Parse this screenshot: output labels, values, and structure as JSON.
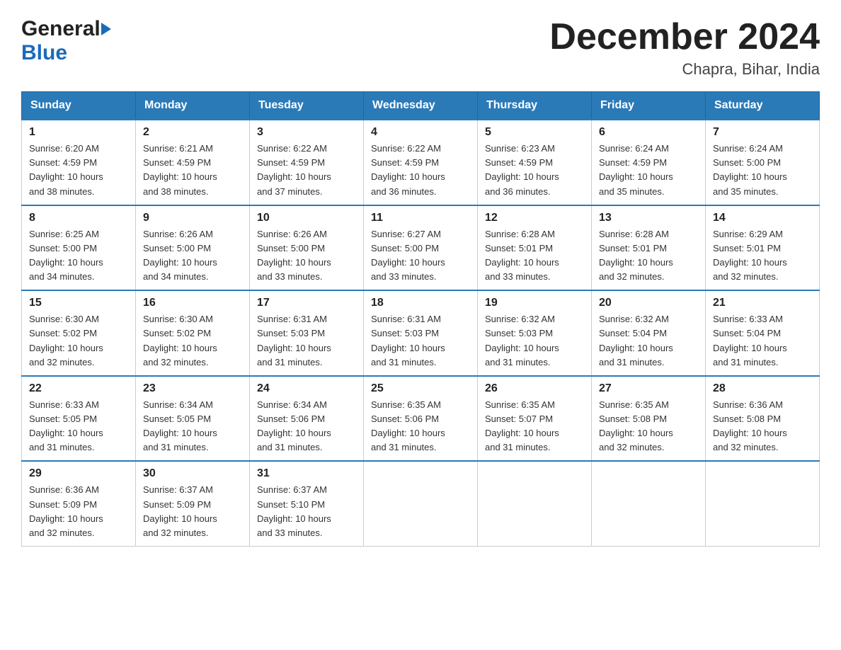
{
  "header": {
    "logo_general": "General",
    "logo_blue": "Blue",
    "month_title": "December 2024",
    "location": "Chapra, Bihar, India"
  },
  "calendar": {
    "days_of_week": [
      "Sunday",
      "Monday",
      "Tuesday",
      "Wednesday",
      "Thursday",
      "Friday",
      "Saturday"
    ],
    "weeks": [
      [
        {
          "day": "1",
          "sunrise": "6:20 AM",
          "sunset": "4:59 PM",
          "daylight": "10 hours and 38 minutes."
        },
        {
          "day": "2",
          "sunrise": "6:21 AM",
          "sunset": "4:59 PM",
          "daylight": "10 hours and 38 minutes."
        },
        {
          "day": "3",
          "sunrise": "6:22 AM",
          "sunset": "4:59 PM",
          "daylight": "10 hours and 37 minutes."
        },
        {
          "day": "4",
          "sunrise": "6:22 AM",
          "sunset": "4:59 PM",
          "daylight": "10 hours and 36 minutes."
        },
        {
          "day": "5",
          "sunrise": "6:23 AM",
          "sunset": "4:59 PM",
          "daylight": "10 hours and 36 minutes."
        },
        {
          "day": "6",
          "sunrise": "6:24 AM",
          "sunset": "4:59 PM",
          "daylight": "10 hours and 35 minutes."
        },
        {
          "day": "7",
          "sunrise": "6:24 AM",
          "sunset": "5:00 PM",
          "daylight": "10 hours and 35 minutes."
        }
      ],
      [
        {
          "day": "8",
          "sunrise": "6:25 AM",
          "sunset": "5:00 PM",
          "daylight": "10 hours and 34 minutes."
        },
        {
          "day": "9",
          "sunrise": "6:26 AM",
          "sunset": "5:00 PM",
          "daylight": "10 hours and 34 minutes."
        },
        {
          "day": "10",
          "sunrise": "6:26 AM",
          "sunset": "5:00 PM",
          "daylight": "10 hours and 33 minutes."
        },
        {
          "day": "11",
          "sunrise": "6:27 AM",
          "sunset": "5:00 PM",
          "daylight": "10 hours and 33 minutes."
        },
        {
          "day": "12",
          "sunrise": "6:28 AM",
          "sunset": "5:01 PM",
          "daylight": "10 hours and 33 minutes."
        },
        {
          "day": "13",
          "sunrise": "6:28 AM",
          "sunset": "5:01 PM",
          "daylight": "10 hours and 32 minutes."
        },
        {
          "day": "14",
          "sunrise": "6:29 AM",
          "sunset": "5:01 PM",
          "daylight": "10 hours and 32 minutes."
        }
      ],
      [
        {
          "day": "15",
          "sunrise": "6:30 AM",
          "sunset": "5:02 PM",
          "daylight": "10 hours and 32 minutes."
        },
        {
          "day": "16",
          "sunrise": "6:30 AM",
          "sunset": "5:02 PM",
          "daylight": "10 hours and 32 minutes."
        },
        {
          "day": "17",
          "sunrise": "6:31 AM",
          "sunset": "5:03 PM",
          "daylight": "10 hours and 31 minutes."
        },
        {
          "day": "18",
          "sunrise": "6:31 AM",
          "sunset": "5:03 PM",
          "daylight": "10 hours and 31 minutes."
        },
        {
          "day": "19",
          "sunrise": "6:32 AM",
          "sunset": "5:03 PM",
          "daylight": "10 hours and 31 minutes."
        },
        {
          "day": "20",
          "sunrise": "6:32 AM",
          "sunset": "5:04 PM",
          "daylight": "10 hours and 31 minutes."
        },
        {
          "day": "21",
          "sunrise": "6:33 AM",
          "sunset": "5:04 PM",
          "daylight": "10 hours and 31 minutes."
        }
      ],
      [
        {
          "day": "22",
          "sunrise": "6:33 AM",
          "sunset": "5:05 PM",
          "daylight": "10 hours and 31 minutes."
        },
        {
          "day": "23",
          "sunrise": "6:34 AM",
          "sunset": "5:05 PM",
          "daylight": "10 hours and 31 minutes."
        },
        {
          "day": "24",
          "sunrise": "6:34 AM",
          "sunset": "5:06 PM",
          "daylight": "10 hours and 31 minutes."
        },
        {
          "day": "25",
          "sunrise": "6:35 AM",
          "sunset": "5:06 PM",
          "daylight": "10 hours and 31 minutes."
        },
        {
          "day": "26",
          "sunrise": "6:35 AM",
          "sunset": "5:07 PM",
          "daylight": "10 hours and 31 minutes."
        },
        {
          "day": "27",
          "sunrise": "6:35 AM",
          "sunset": "5:08 PM",
          "daylight": "10 hours and 32 minutes."
        },
        {
          "day": "28",
          "sunrise": "6:36 AM",
          "sunset": "5:08 PM",
          "daylight": "10 hours and 32 minutes."
        }
      ],
      [
        {
          "day": "29",
          "sunrise": "6:36 AM",
          "sunset": "5:09 PM",
          "daylight": "10 hours and 32 minutes."
        },
        {
          "day": "30",
          "sunrise": "6:37 AM",
          "sunset": "5:09 PM",
          "daylight": "10 hours and 32 minutes."
        },
        {
          "day": "31",
          "sunrise": "6:37 AM",
          "sunset": "5:10 PM",
          "daylight": "10 hours and 33 minutes."
        },
        null,
        null,
        null,
        null
      ]
    ],
    "labels": {
      "sunrise": "Sunrise:",
      "sunset": "Sunset:",
      "daylight": "Daylight:"
    }
  }
}
